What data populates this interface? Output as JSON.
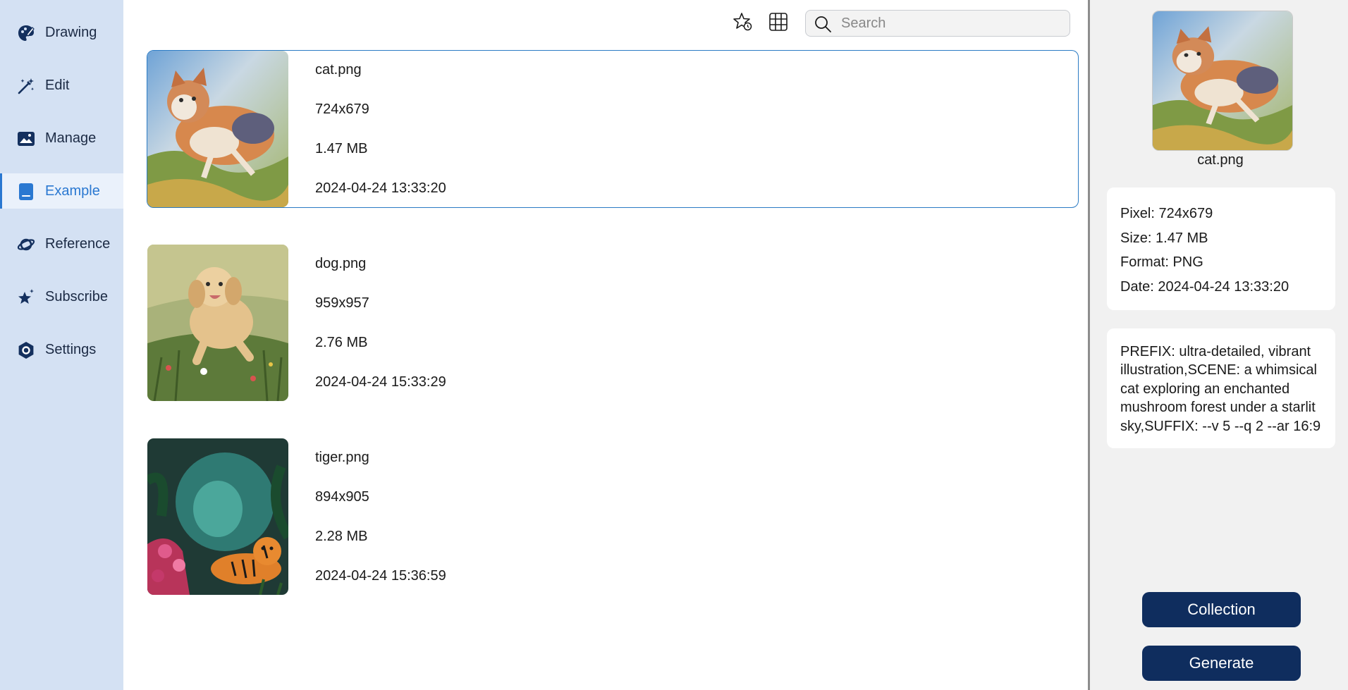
{
  "sidebar": {
    "items": [
      {
        "label": "Drawing",
        "icon": "palette-icon",
        "active": false
      },
      {
        "label": "Edit",
        "icon": "magic-wand-icon",
        "active": false
      },
      {
        "label": "Manage",
        "icon": "image-icon",
        "active": false
      },
      {
        "label": "Example",
        "icon": "book-icon",
        "active": true
      },
      {
        "label": "Reference",
        "icon": "planet-icon",
        "active": false
      },
      {
        "label": "Subscribe",
        "icon": "star-sparkle-icon",
        "active": false
      },
      {
        "label": "Settings",
        "icon": "gear-icon",
        "active": false
      }
    ]
  },
  "toolbar": {
    "favorite_icon": "star-clock-icon",
    "grid_icon": "grid-icon",
    "search": {
      "placeholder": "Search",
      "value": ""
    }
  },
  "images": [
    {
      "name": "cat.png",
      "dimensions": "724x679",
      "size": "1.47 MB",
      "date": "2024-04-24 13:33:20",
      "selected": true
    },
    {
      "name": "dog.png",
      "dimensions": "959x957",
      "size": "2.76 MB",
      "date": "2024-04-24 15:33:29",
      "selected": false
    },
    {
      "name": "tiger.png",
      "dimensions": "894x905",
      "size": "2.28 MB",
      "date": "2024-04-24 15:36:59",
      "selected": false
    }
  ],
  "detail": {
    "name": "cat.png",
    "pixel": "Pixel: 724x679",
    "size": "Size: 1.47 MB",
    "format": "Format: PNG",
    "date": "Date: 2024-04-24 13:33:20",
    "prompt": "PREFIX: ultra-detailed, vibrant illustration,SCENE: a whimsical cat exploring an enchanted mushroom forest under a starlit sky,SUFFIX: --v 5 --q 2 --ar 16:9"
  },
  "actions": {
    "collection_label": "Collection",
    "generate_label": "Generate"
  },
  "colors": {
    "sidebar_bg": "#d4e1f3",
    "accent": "#2a78d1",
    "button_bg": "#0f2d5e",
    "right_panel_bg": "#f1f1f1"
  }
}
